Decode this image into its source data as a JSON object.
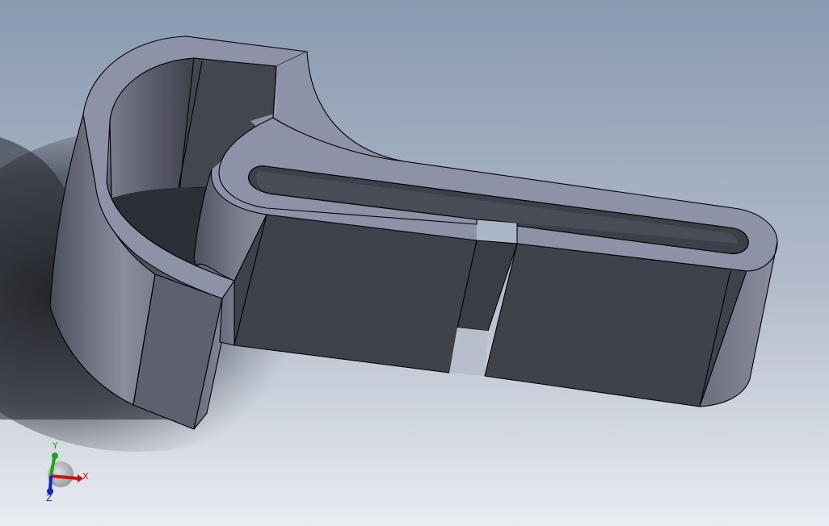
{
  "viewport": {
    "background_top": "#8a9bb0",
    "background_bottom": "#e8ebf0"
  },
  "model": {
    "face_dark": "#3d4049",
    "face_top": "#8e92a6",
    "face_side_light": "#8a8c9c",
    "edge": "#000000"
  },
  "triad": {
    "x_label": "X",
    "y_label": "Y",
    "z_label": "Z",
    "x_color": "#cc1111",
    "y_color": "#11aa11",
    "z_color": "#1122cc"
  }
}
